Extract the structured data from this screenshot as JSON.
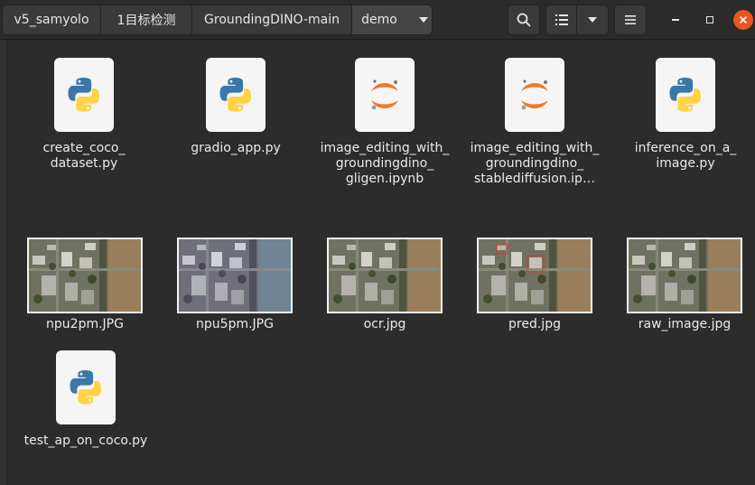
{
  "breadcrumbs": [
    "v5_samyolo",
    "1目标检测",
    "GroundingDINO-main",
    "demo"
  ],
  "toolbar": {
    "search_icon": "search-icon",
    "view_icon": "list-view-icon",
    "view_dropdown_icon": "chevron-down-icon",
    "menu_icon": "hamburger-menu-icon"
  },
  "window": {
    "minimize_icon": "minimize-icon",
    "maximize_icon": "maximize-icon",
    "close_icon": "close-icon",
    "close_color": "#e95420"
  },
  "files": [
    {
      "name": "create_coco_\ndataset.py",
      "type": "python"
    },
    {
      "name": "gradio_app.py",
      "type": "python"
    },
    {
      "name": "image_editing_with_\ngroundingdino_\ngligen.ipynb",
      "type": "jupyter"
    },
    {
      "name": "image_editing_with_\ngroundingdino_\nstablediffusion.ip…",
      "type": "jupyter"
    },
    {
      "name": "inference_on_a_\nimage.py",
      "type": "python"
    },
    {
      "name": "npu2pm.JPG",
      "type": "image"
    },
    {
      "name": "npu5pm.JPG",
      "type": "image"
    },
    {
      "name": "ocr.jpg",
      "type": "image"
    },
    {
      "name": "pred.jpg",
      "type": "image"
    },
    {
      "name": "raw_image.jpg",
      "type": "image"
    },
    {
      "name": "test_ap_on_coco.py",
      "type": "python"
    }
  ],
  "colors": {
    "python_blue": "#3b77a8",
    "python_yellow": "#ffd343",
    "jupyter_orange": "#f37726"
  }
}
